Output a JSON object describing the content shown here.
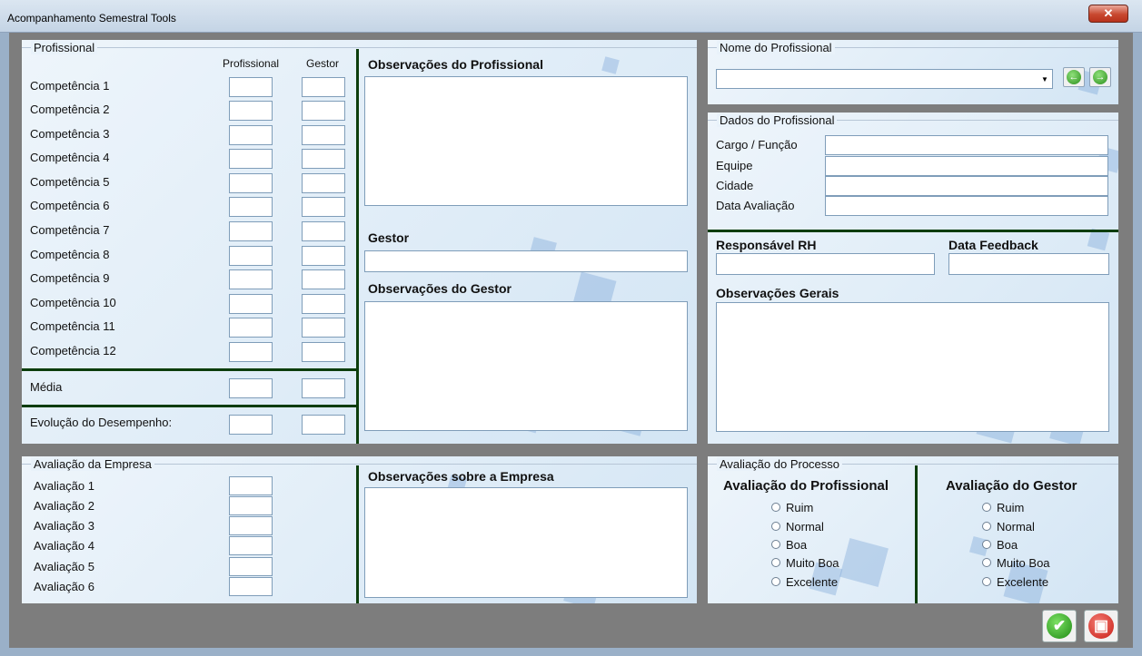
{
  "window": {
    "title": "Acompanhamento Semestral Tools",
    "close_glyph": "✕"
  },
  "profissional": {
    "group_label": "Profissional",
    "col_profissional": "Profissional",
    "col_gestor": "Gestor",
    "competencias": [
      "Competência 1",
      "Competência 2",
      "Competência 3",
      "Competência 4",
      "Competência 5",
      "Competência 6",
      "Competência 7",
      "Competência 8",
      "Competência 9",
      "Competência 10",
      "Competência 11",
      "Competência 12"
    ],
    "media_label": "Média",
    "evolucao_label": "Evolução do Desempenho:"
  },
  "observacoes": {
    "profissional_label": "Observações do Profissional",
    "gestor_label": "Gestor",
    "gestor_obs_label": "Observações do Gestor"
  },
  "nome": {
    "group_label": "Nome do Profissional",
    "selected": "",
    "prev_icon": "arrow-left-icon",
    "next_icon": "arrow-right-icon"
  },
  "dados": {
    "group_label": "Dados do Profissional",
    "fields": [
      "Cargo / Função",
      "Equipe",
      "Cidade",
      "Data Avaliação"
    ],
    "responsavel_label": "Responsável RH",
    "data_feedback_label": "Data Feedback",
    "obs_gerais_label": "Observações Gerais"
  },
  "empresa": {
    "group_label": "Avaliação da Empresa",
    "items": [
      "Avaliação 1",
      "Avaliação 2",
      "Avaliação 3",
      "Avaliação 4",
      "Avaliação 5",
      "Avaliação 6"
    ],
    "obs_label": "Observações sobre a Empresa"
  },
  "processo": {
    "group_label": "Avaliação do Processo",
    "profissional_label": "Avaliação do Profissional",
    "gestor_label": "Avaliação do Gestor",
    "options": [
      "Ruim",
      "Normal",
      "Boa",
      "Muito Boa",
      "Excelente"
    ]
  },
  "actions": {
    "ok_icon": "check-icon",
    "save_icon": "save-icon",
    "ok_glyph": "✔",
    "save_glyph": "▣"
  },
  "colors": {
    "accent_green": "#0c3d0c",
    "ok_green": "#2a9a1c",
    "save_red": "#d8332a"
  }
}
